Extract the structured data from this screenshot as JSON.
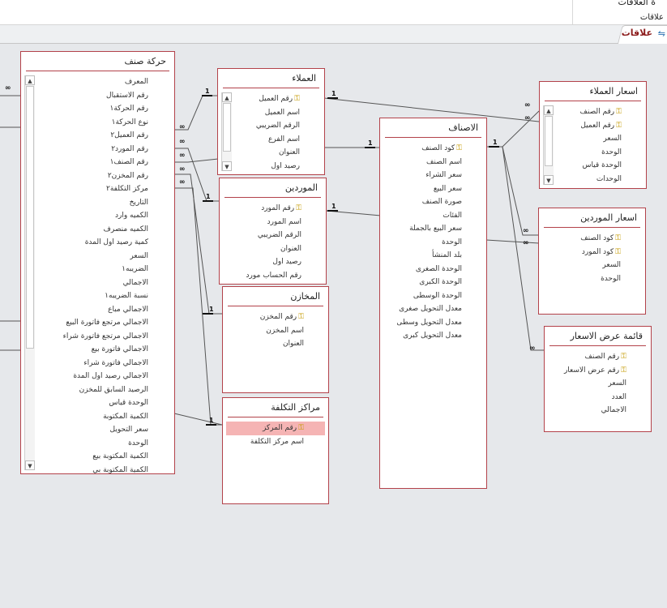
{
  "ribbon": {
    "group_name": "ة العلاقات",
    "group_sub": "علاقات"
  },
  "tab": {
    "label": "علاقات",
    "icon": "relationships-icon"
  },
  "markers": {
    "one": "1",
    "many": "∞"
  },
  "tables": {
    "harakat_sanf": {
      "title": "حركة صنف",
      "fields": [
        "المعرف",
        "رقم الاستقبال",
        "رقم الحركة١",
        "نوع الحركة١",
        "رقم العميل٢",
        "رقم المورد٢",
        "رقم الصنف١",
        "رقم المخزن٢",
        "مركز التكلفة٢",
        "التاريخ",
        "الكميه وارد",
        "الكميه منصرف",
        "كمية رصيد اول المدة",
        "السعر",
        "الضريبه١",
        "الاجمالي",
        "نسبة الضريبه١",
        "الاجمالي مباع",
        "الاجمالي مرتجع فاتورة البيع",
        "الاجمالي مرتجع فاتورة شراء",
        "الاجمالي فاتورة بيع",
        "الاجمالي فاتورة شراء",
        "الاجمالي رصيد اول المدة",
        "الرصيد السابق للمخزن",
        "الوحدة قياس",
        "الكمية المكتوبة",
        "سعر التحويل",
        "الوحدة",
        "الكمية المكتوبة بيع",
        "الكمية المكتوبة بي"
      ]
    },
    "omalaa": {
      "title": "العملاء",
      "fields": [
        "رقم العميل",
        "اسم العميل",
        "الرقم الضريبي",
        "اسم الفرع",
        "العنوان",
        "رصيد اول"
      ]
    },
    "mowarideen": {
      "title": "الموردين",
      "fields": [
        "رقم المورد",
        "اسم المورد",
        "الرقم الضريبي",
        "العنوان",
        "رصيد اول",
        "رقم الحساب مورد"
      ]
    },
    "makhazen": {
      "title": "المخازن",
      "fields": [
        "رقم المخزن",
        "اسم المخزن",
        "العنوان"
      ]
    },
    "marakez": {
      "title": "مراكز التكلفة",
      "fields": [
        "رقم المركز",
        "اسم مركز التكلفة"
      ]
    },
    "asnaf": {
      "title": "الاصناف",
      "fields": [
        "كود الصنف",
        "اسم الصنف",
        "سعر الشراء",
        "سعر البيع",
        "صورة الصنف",
        "الفئات",
        "سعر البيع بالجملة",
        "الوحدة",
        "بلد المنشأ",
        "الوحدة الصغرى",
        "الوحدة الكبرى",
        "الوحدة الوسطى",
        "معدل التحويل صغرى",
        "معدل التحويل وسطى",
        "معدل التحويل كبرى"
      ]
    },
    "asaar_omalaa": {
      "title": "اسعار العملاء",
      "fields": [
        "رقم الصنف",
        "رقم العميل",
        "السعر",
        "الوحدة",
        "الوحدة قياس",
        "الوحدات"
      ]
    },
    "asaar_mowarideen": {
      "title": "اسعار الموردين",
      "fields": [
        "كود الصنف",
        "كود المورد",
        "السعر",
        "الوحدة"
      ]
    },
    "qaemat_ard": {
      "title": "قائمة عرض الاسعار",
      "fields": [
        "رقم الصنف",
        "رقم عرض الاسعار",
        "السعر",
        "العدد",
        "الاجمالي"
      ]
    }
  },
  "colors": {
    "table_border": "#b3424a",
    "selected_field": "#f5b4b4",
    "canvas": "#e6e8eb",
    "lines": "#555555",
    "key_icon": "#c59a00"
  }
}
